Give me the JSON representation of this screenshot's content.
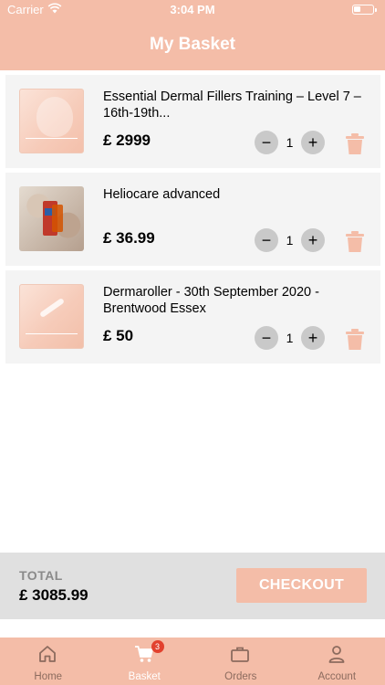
{
  "status_bar": {
    "carrier": "Carrier",
    "time": "3:04 PM"
  },
  "header": {
    "title": "My Basket"
  },
  "basket": {
    "items": [
      {
        "name": "Essential Dermal Fillers Training – Level 7 – 16th-19th...",
        "price": "£ 2999",
        "quantity": "1",
        "thumbnail": "dermal-fillers-thumbnail"
      },
      {
        "name": "Heliocare advanced",
        "price": "£ 36.99",
        "quantity": "1",
        "thumbnail": "heliocare-thumbnail"
      },
      {
        "name": "Dermaroller - 30th September 2020 - Brentwood Essex",
        "price": "£ 50",
        "quantity": "1",
        "thumbnail": "dermaroller-thumbnail"
      }
    ],
    "minus_symbol": "−",
    "plus_symbol": "+"
  },
  "footer": {
    "total_label": "TOTAL",
    "total_value": "£ 3085.99",
    "checkout_label": "CHECKOUT"
  },
  "tabbar": {
    "tabs": [
      {
        "label": "Home",
        "icon": "home-icon"
      },
      {
        "label": "Basket",
        "icon": "cart-icon",
        "badge": "3",
        "active": true
      },
      {
        "label": "Orders",
        "icon": "briefcase-icon"
      },
      {
        "label": "Account",
        "icon": "person-icon"
      }
    ]
  },
  "colors": {
    "accent": "#f4bda8",
    "badge": "#e2412e",
    "card": "#f4f4f4",
    "total_bar": "#e0e0e0"
  }
}
